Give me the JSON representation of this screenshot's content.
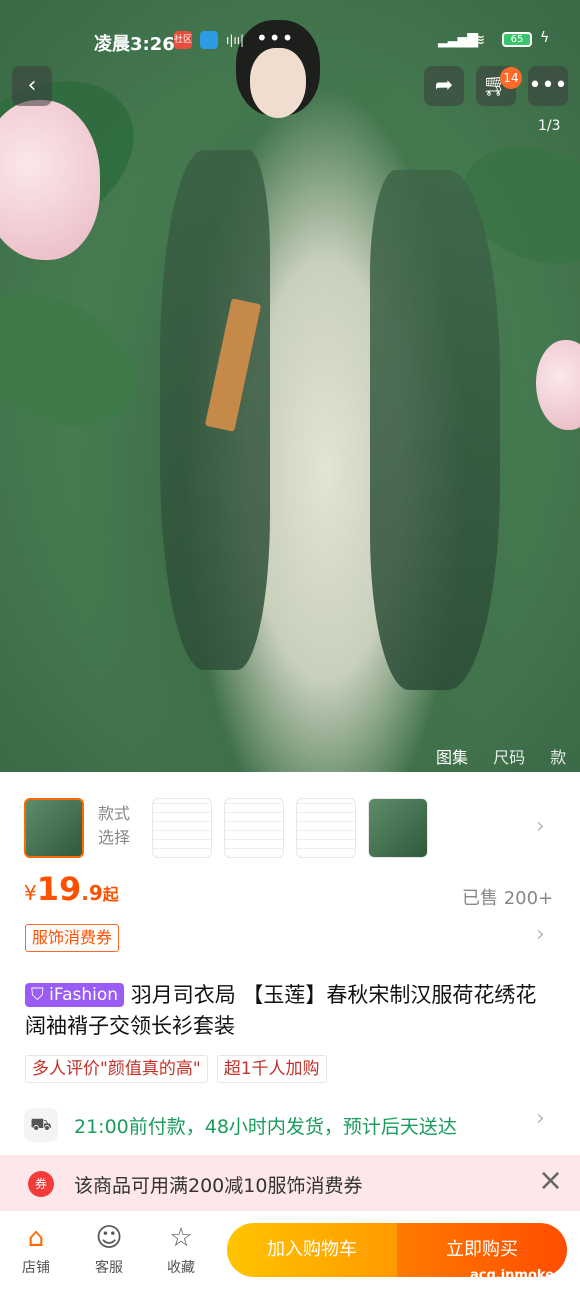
{
  "status_bar": {
    "time": "凌晨3:26",
    "app1_label": "社区",
    "battery": "65"
  },
  "topbar": {
    "back_icon": "chevron-left-icon",
    "share_icon": "share-arrow-icon",
    "cart_icon": "shopping-cart-icon",
    "cart_count": "14",
    "more_icon": "more-dots-icon"
  },
  "gallery": {
    "page_indicator": "1/3",
    "tabs": [
      "图集",
      "尺码",
      "款式"
    ],
    "active_tab": "图集"
  },
  "variants": {
    "label_line1": "款式",
    "label_line2": "选择"
  },
  "price": {
    "currency": "¥",
    "integer": "19",
    "decimal": ".9",
    "suffix": "起",
    "sold": "已售 200+",
    "coupon": "服饰消费券"
  },
  "product": {
    "brand_badge": "iFashion",
    "title": "羽月司衣局 【玉莲】春秋宋制汉服荷花绣花阔袖褙子交领长衫套装",
    "chips": [
      "多人评价\"颜值真的高\"",
      "超1千人加购"
    ]
  },
  "shipping": {
    "text": "21:00前付款，48小时内发货，预计后天送达"
  },
  "banner": {
    "text": "该商品可用满200减10服饰消费券"
  },
  "bottom_bar": {
    "shop": "店铺",
    "service": "客服",
    "favorite": "收藏",
    "add_to_cart": "加入购物车",
    "buy_now": "立即购买"
  },
  "watermark": "acg.inmoke.com",
  "colors": {
    "accent": "#ff5000",
    "ship_green": "#1a9c5c",
    "ifashion_purple": "#9a5cf5",
    "cart_button": "#ffb000",
    "buy_button": "#ff5a00"
  }
}
